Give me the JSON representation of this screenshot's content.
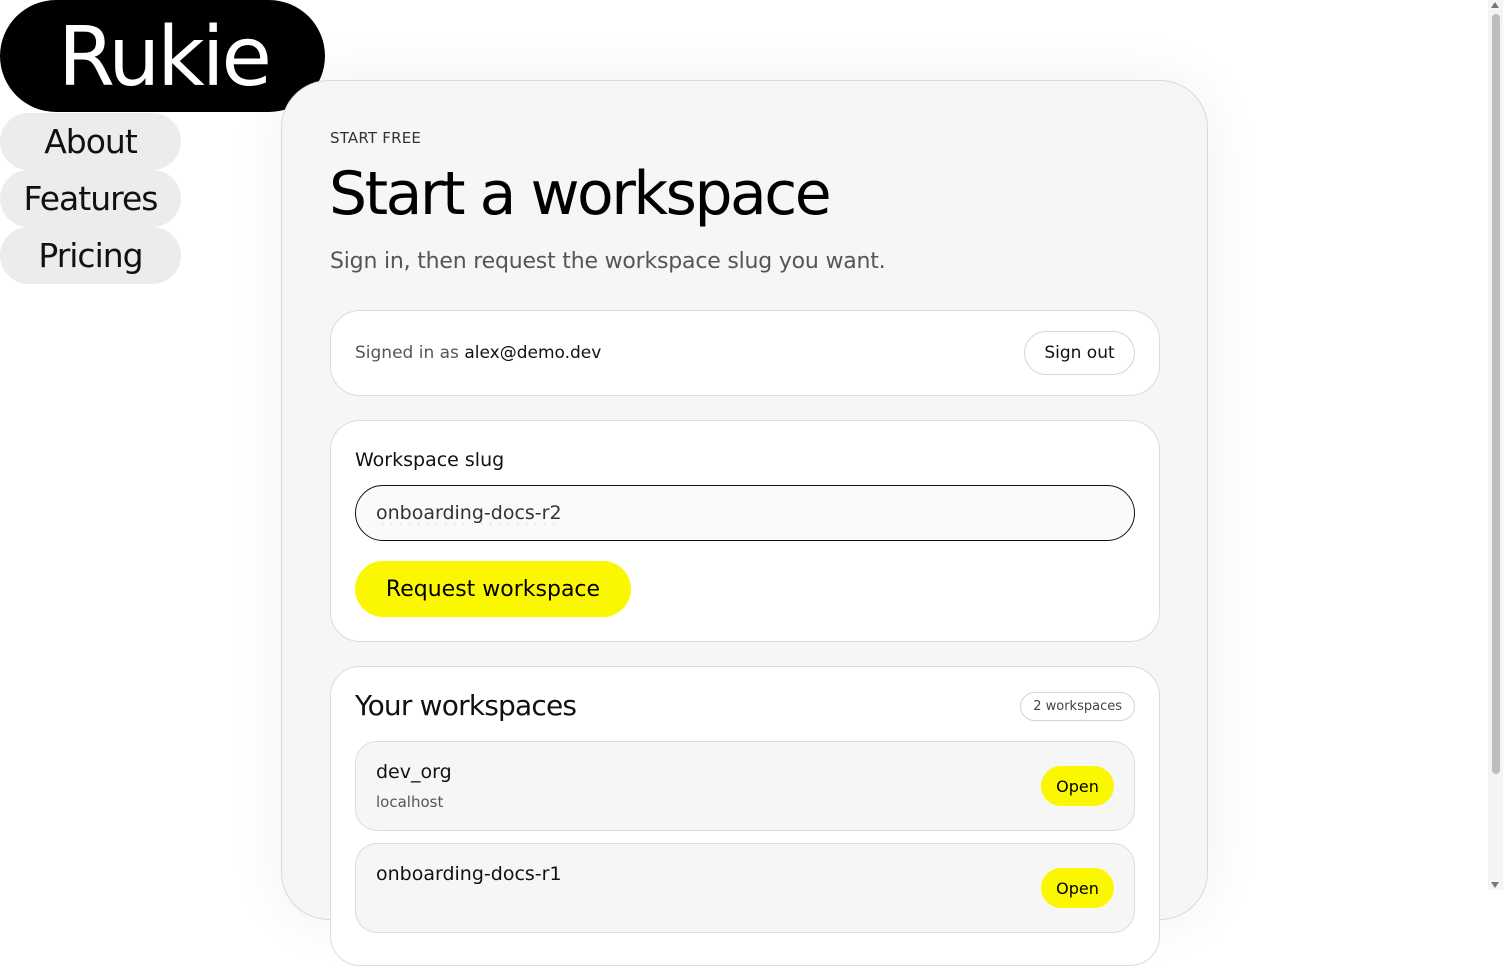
{
  "brand": {
    "logo_text": "Rukie"
  },
  "nav": {
    "items": [
      {
        "label": "About"
      },
      {
        "label": "Features"
      },
      {
        "label": "Pricing"
      }
    ]
  },
  "hero": {
    "eyebrow": "START FREE",
    "title": "Start a workspace",
    "subtitle": "Sign in, then request the workspace slug you want."
  },
  "auth": {
    "signed_in_prefix": "Signed in as ",
    "email": "alex@demo.dev",
    "sign_out_label": "Sign out"
  },
  "request": {
    "field_label": "Workspace slug",
    "slug_value": "onboarding-docs-r2",
    "submit_label": "Request workspace"
  },
  "workspaces": {
    "heading": "Your workspaces",
    "count_label": "2 workspaces",
    "items": [
      {
        "name": "dev_org",
        "host": "localhost",
        "open_label": "Open"
      },
      {
        "name": "onboarding-docs-r1",
        "host": "",
        "open_label": "Open"
      }
    ]
  },
  "colors": {
    "accent": "#fbf700",
    "logo_bg": "#000000",
    "nav_bg": "#ececec",
    "card_bg": "#f6f6f6"
  }
}
